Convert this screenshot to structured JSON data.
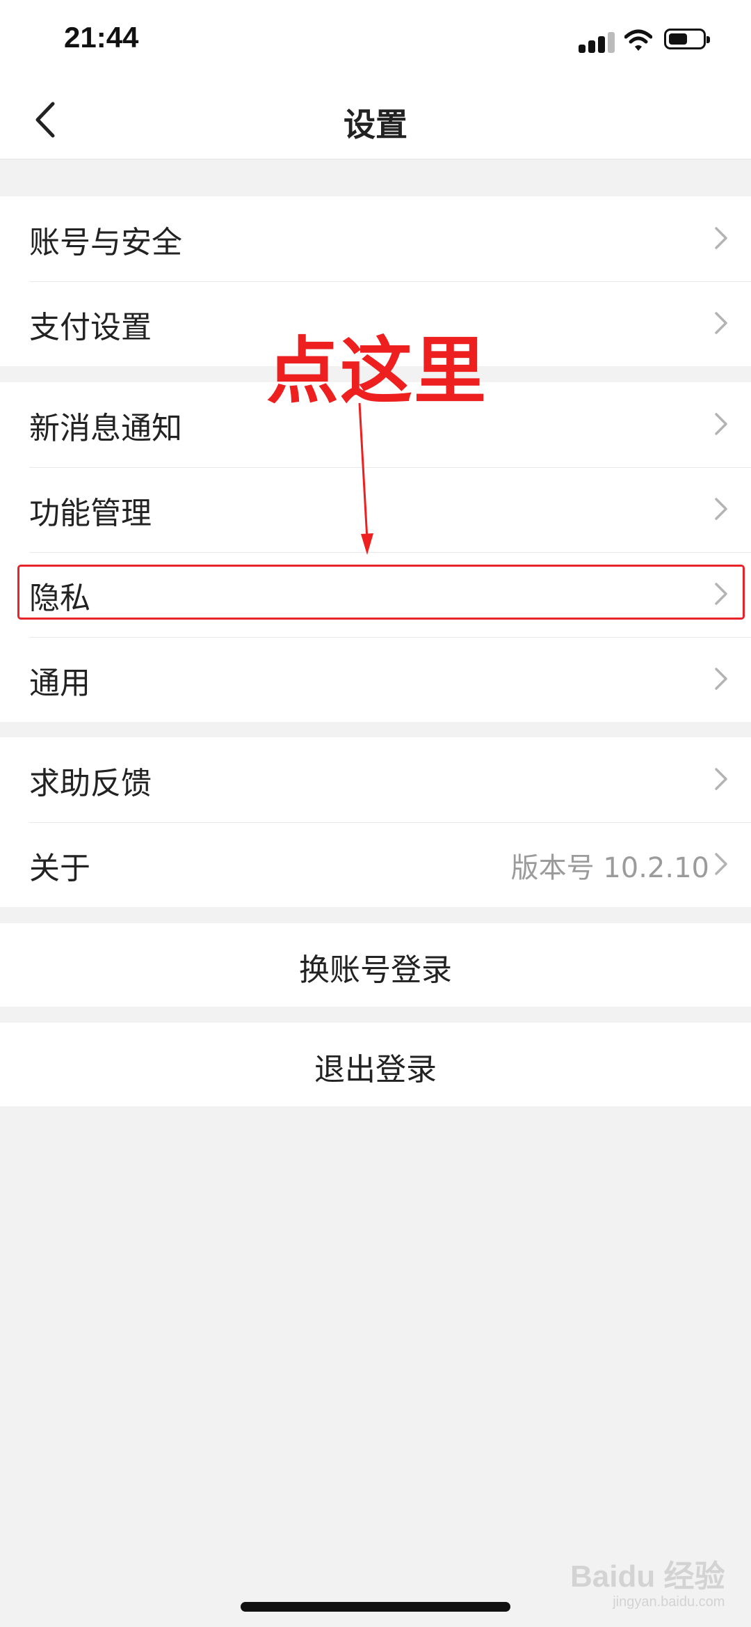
{
  "status_bar": {
    "time": "21:44"
  },
  "nav": {
    "title": "设置"
  },
  "groups": [
    {
      "items": [
        {
          "label": "账号与安全"
        },
        {
          "label": "支付设置"
        }
      ]
    },
    {
      "items": [
        {
          "label": "新消息通知"
        },
        {
          "label": "功能管理"
        },
        {
          "label": "隐私"
        },
        {
          "label": "通用"
        }
      ]
    },
    {
      "items": [
        {
          "label": "求助反馈"
        },
        {
          "label": "关于",
          "value": "版本号 10.2.10"
        }
      ]
    }
  ],
  "actions": {
    "switch_account": "换账号登录",
    "logout": "退出登录"
  },
  "annotation": {
    "text": "点这里",
    "color": "#ee1f1f",
    "highlighted_item": "隐私"
  },
  "watermark": {
    "brand": "Baidu 经验",
    "site": "jingyan.baidu.com"
  }
}
